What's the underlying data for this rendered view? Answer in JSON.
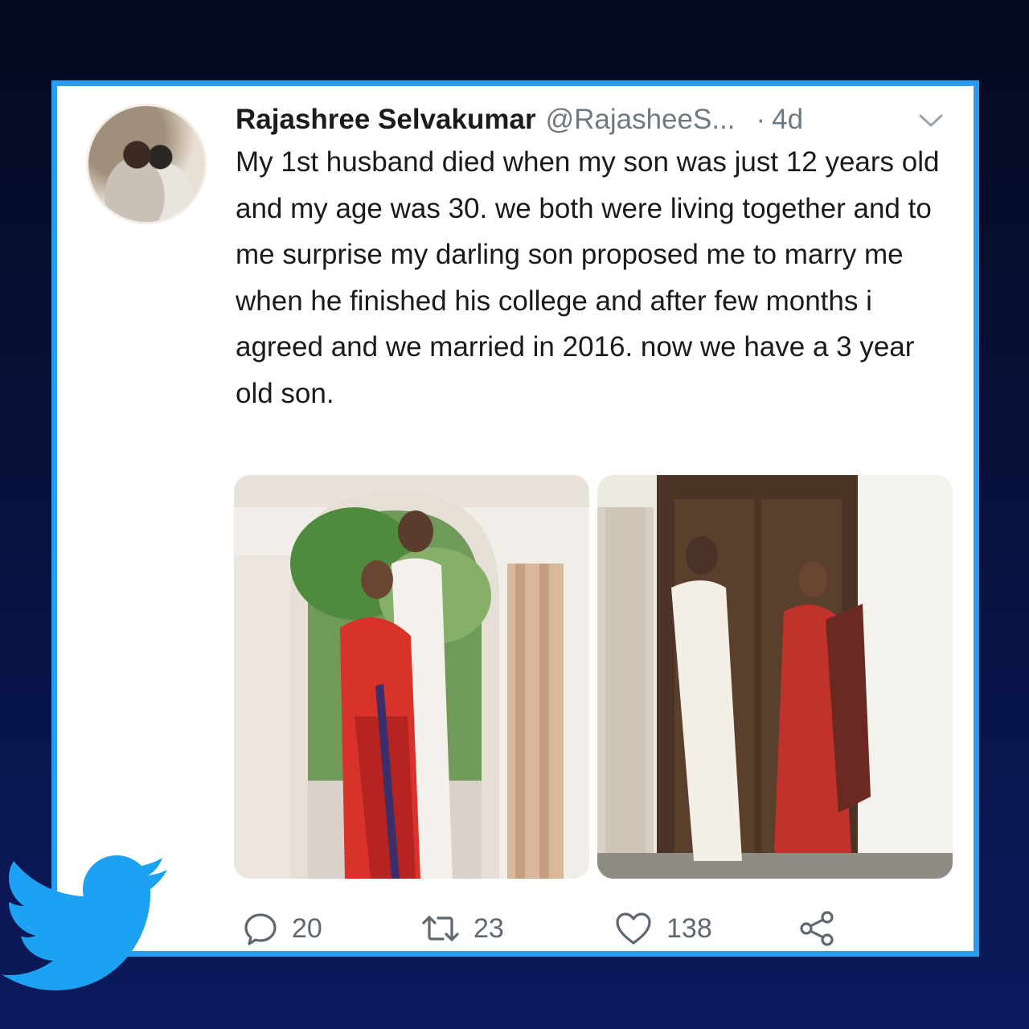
{
  "tweet": {
    "author_name": "Rajashree Selvakumar",
    "handle": "@RajasheeS...",
    "separator": "·",
    "time": "4d",
    "text": "My 1st husband died when my son was just 12 years old and my age was 30. we both were living together and to me surprise my darling son proposed me to marry me when he finished his college and after few months i agreed and we married in 2016. now we have a 3 year old son.",
    "avatar_icon": "profile-photo",
    "menu_icon": "chevron-down-icon"
  },
  "actions": {
    "replies": "20",
    "retweets": "23",
    "likes": "138",
    "reply_icon": "reply-icon",
    "retweet_icon": "retweet-icon",
    "like_icon": "heart-icon",
    "share_icon": "share-icon"
  },
  "colors": {
    "frame_accent": "#2a9cf0",
    "twitter_blue": "#1da1f2",
    "background_dark": "#07113a"
  },
  "branding": {
    "logo": "twitter-bird-logo"
  }
}
